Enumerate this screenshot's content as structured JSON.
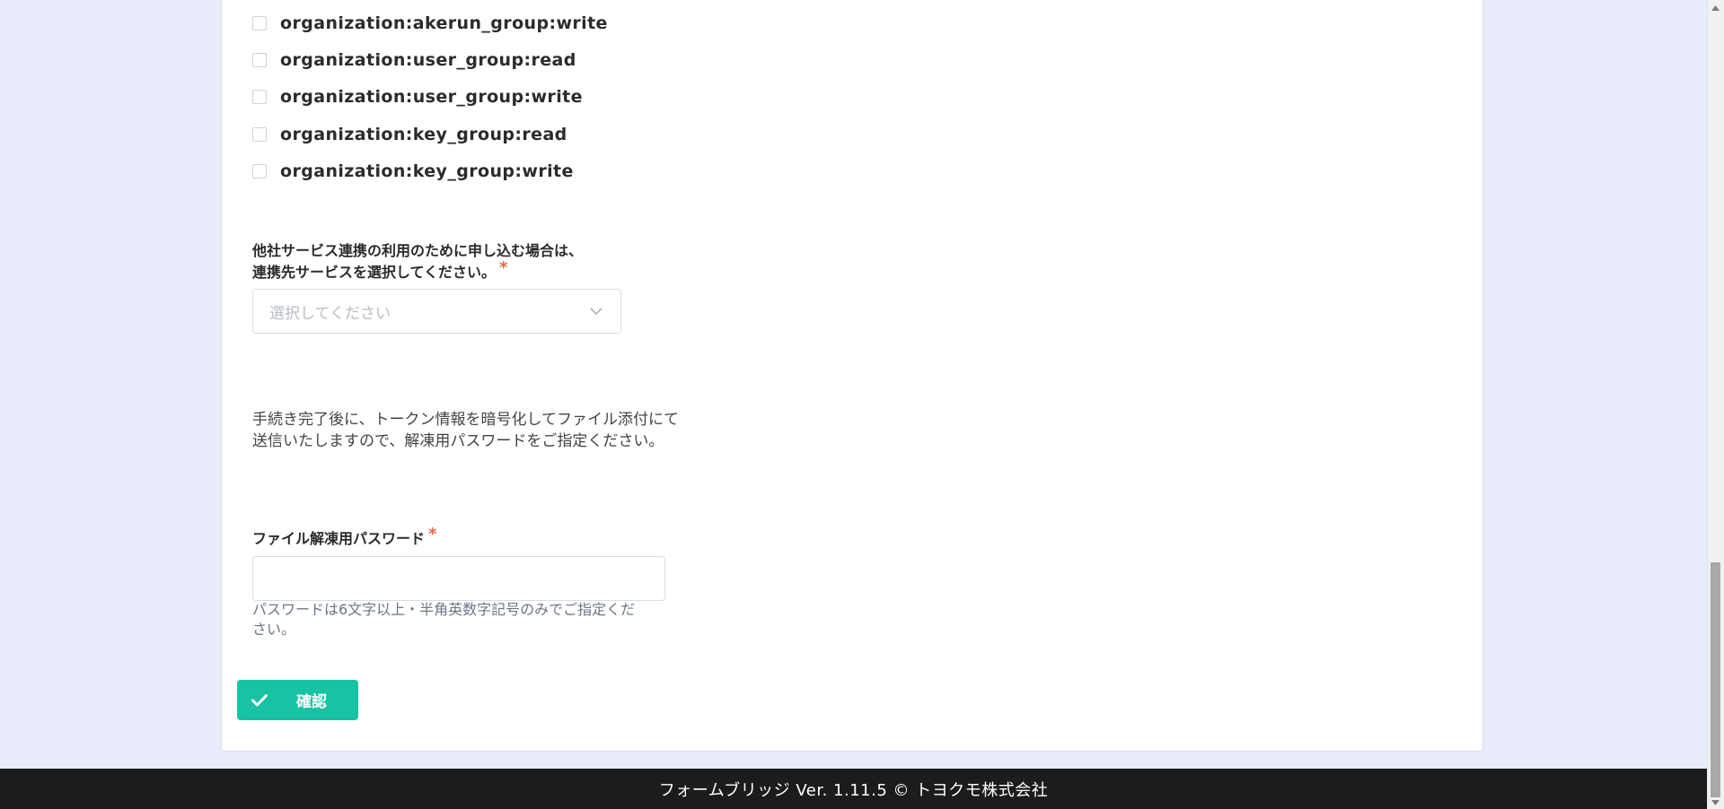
{
  "scopes": [
    {
      "label": "organization:akerun_group:write",
      "checked": false
    },
    {
      "label": "organization:user_group:read",
      "checked": false
    },
    {
      "label": "organization:user_group:write",
      "checked": false
    },
    {
      "label": "organization:key_group:read",
      "checked": false
    },
    {
      "label": "organization:key_group:write",
      "checked": false
    }
  ],
  "service_select": {
    "label_line1": "他社サービス連携の利用のために申し込む場合は、",
    "label_line2": "連携先サービスを選択してください。",
    "required_mark": "*",
    "placeholder": "選択してください"
  },
  "info": {
    "line1": "手続き完了後に、トークン情報を暗号化してファイル添付にて",
    "line2": "送信いたしますので、解凍用パスワードをご指定ください。"
  },
  "password_field": {
    "label": "ファイル解凍用パスワード",
    "required_mark": "*",
    "value": "",
    "help_line1": "パスワードは6文字以上・半角英数字記号のみでご指定くだ",
    "help_line2": "さい。"
  },
  "confirm_button": {
    "label": "確認"
  },
  "footer": {
    "text": "フォームブリッジ  Ver. 1.11.5  © トヨクモ株式会社"
  },
  "colors": {
    "accent": "#17c3a2",
    "required": "#e8664a",
    "background": "#e9edfb",
    "footer_bg": "#1b1c1e"
  }
}
